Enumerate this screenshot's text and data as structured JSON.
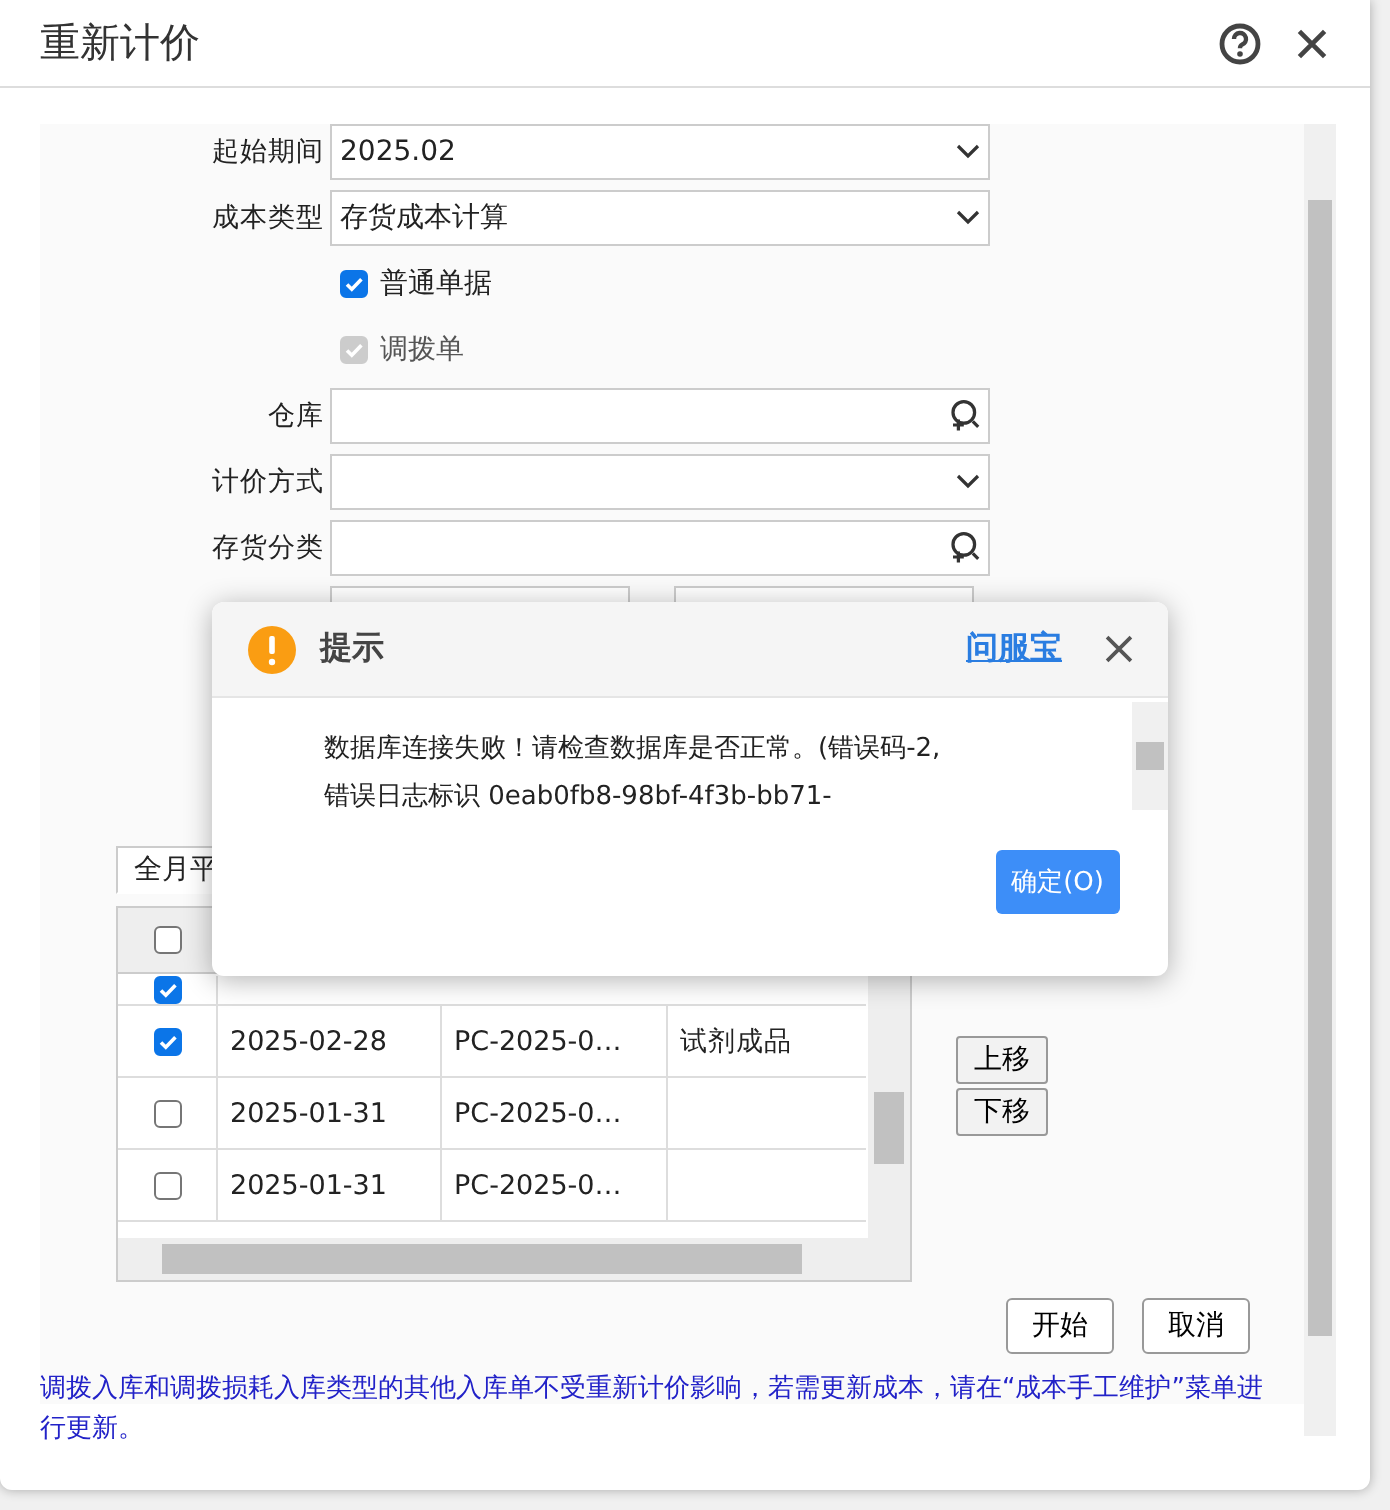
{
  "window": {
    "title": "重新计价"
  },
  "form": {
    "fields": [
      {
        "kind": "select",
        "label": "起始期间",
        "value": "2025.02"
      },
      {
        "kind": "select",
        "label": "成本类型",
        "value": "存货成本计算"
      },
      {
        "kind": "checkbox",
        "label": "普通单据",
        "checked": true,
        "disabled": false
      },
      {
        "kind": "checkbox",
        "label": "调拨单",
        "checked": true,
        "disabled": true
      },
      {
        "kind": "lookup",
        "label": "仓库"
      },
      {
        "kind": "select",
        "label": "计价方式"
      },
      {
        "kind": "lookup",
        "label": "存货分类"
      },
      {
        "kind": "range"
      }
    ]
  },
  "tabs": [
    {
      "label": "全月平",
      "selected": true
    }
  ],
  "table": {
    "header_checked": false,
    "rows": [
      {
        "checked": true
      },
      {
        "checked": true,
        "cells": [
          "2025-02-28",
          "PC-2025-0…",
          "试剂成品"
        ]
      },
      {
        "checked": false,
        "cells": [
          "2025-01-31",
          "PC-2025-0…"
        ]
      },
      {
        "checked": false,
        "cells": [
          "2025-01-31",
          "PC-2025-0…"
        ]
      }
    ]
  },
  "side_buttons": [
    "上移",
    "下移"
  ],
  "buttons": [
    "开始",
    "取消"
  ],
  "note": "调拨入库和调拨损耗入库类型的其他入库单不受重新计价影响，若需更新成本，请在“成本手工维护”菜单进行更新。",
  "dialog": {
    "title": "提示",
    "link": "问服宝",
    "message": "数据库连接失败！请检查数据库是否正常。(错误码-2,\n错误日志标识 0eab0fb8-98bf-4f3b-bb71-",
    "button": "确定(O)"
  }
}
